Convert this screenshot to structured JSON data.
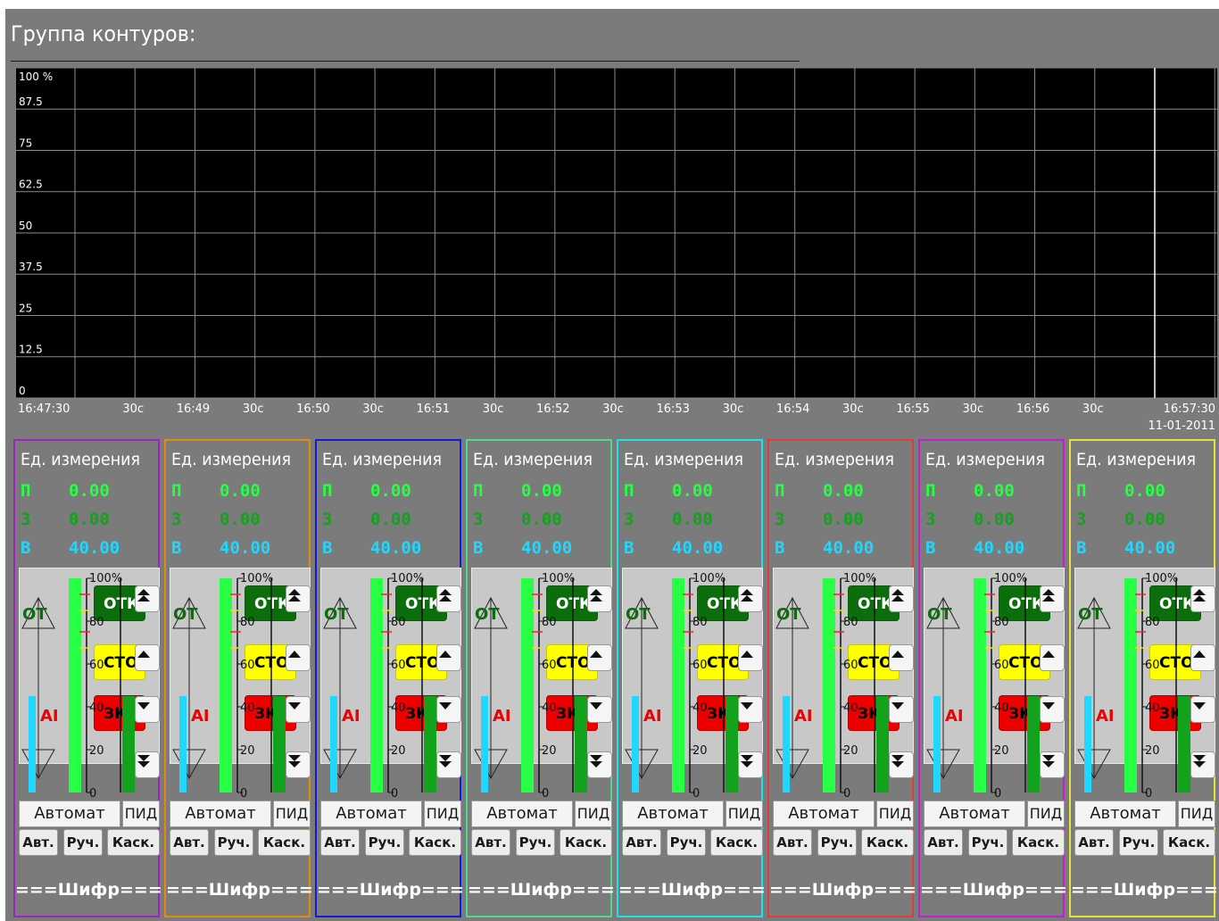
{
  "title": "Группа контуров:",
  "trend": {
    "y_ticks": [
      "100 %",
      "87.5",
      "75",
      "62.5",
      "50",
      "37.5",
      "25",
      "12.5",
      "0"
    ],
    "x_ticks": [
      "16:47:30",
      "30с",
      "16:49",
      "30с",
      "16:50",
      "30с",
      "16:51",
      "30с",
      "16:52",
      "30с",
      "16:53",
      "30с",
      "16:54",
      "30с",
      "16:55",
      "30с",
      "16:56",
      "30с",
      "16:57:30"
    ],
    "date": "11-01-2011",
    "background": "#000000",
    "grid_color": "#8c8c8c"
  },
  "colors": {
    "pv": "#26ff44",
    "sp": "#12a21c",
    "out": "#20d8ff",
    "alarm_hh": "#0b6d0b",
    "alarm_h": "#ffff00",
    "alarm_l": "#ee0000"
  },
  "gauge": {
    "scale": [
      "100%",
      "80",
      "60",
      "40",
      "20",
      "0"
    ],
    "left_letters": [
      "ОТ",
      "АI"
    ],
    "alarm_hh_label": "ОТК",
    "alarm_h_label": "СТО",
    "alarm_l_label": "ЗК"
  },
  "panels": [
    {
      "border": "#a020c0",
      "unit": "Ед. измерения",
      "p_label": "П",
      "p": "0.00",
      "z_label": "З",
      "z": "0.00",
      "v_label": "В",
      "v": "40.00",
      "pv_level": 1.0,
      "sp_level": 0.45,
      "out_level": 0.45,
      "mode": "Автомат",
      "algo": "ПИД",
      "btn_auto": "Авт.",
      "btn_manual": "Руч.",
      "btn_cascade": "Каск.",
      "cipher": "===Шифр==="
    },
    {
      "border": "#e08a10",
      "unit": "Ед. измерения",
      "p_label": "П",
      "p": "0.00",
      "z_label": "З",
      "z": "0.00",
      "v_label": "В",
      "v": "40.00",
      "pv_level": 1.0,
      "sp_level": 0.45,
      "out_level": 0.45,
      "mode": "Автомат",
      "algo": "ПИД",
      "btn_auto": "Авт.",
      "btn_manual": "Руч.",
      "btn_cascade": "Каск.",
      "cipher": "===Шифр==="
    },
    {
      "border": "#1818d0",
      "unit": "Ед. измерения",
      "p_label": "П",
      "p": "0.00",
      "z_label": "З",
      "z": "0.00",
      "v_label": "В",
      "v": "40.00",
      "pv_level": 1.0,
      "sp_level": 0.45,
      "out_level": 0.45,
      "mode": "Автомат",
      "algo": "ПИД",
      "btn_auto": "Авт.",
      "btn_manual": "Руч.",
      "btn_cascade": "Каск.",
      "cipher": "===Шифр==="
    },
    {
      "border": "#50d890",
      "unit": "Ед. измерения",
      "p_label": "П",
      "p": "0.00",
      "z_label": "З",
      "z": "0.00",
      "v_label": "В",
      "v": "40.00",
      "pv_level": 1.0,
      "sp_level": 0.45,
      "out_level": 0.45,
      "mode": "Автомат",
      "algo": "ПИД",
      "btn_auto": "Авт.",
      "btn_manual": "Руч.",
      "btn_cascade": "Каск.",
      "cipher": "===Шифр==="
    },
    {
      "border": "#20e0e8",
      "unit": "Ед. измерения",
      "p_label": "П",
      "p": "0.00",
      "z_label": "З",
      "z": "0.00",
      "v_label": "В",
      "v": "40.00",
      "pv_level": 1.0,
      "sp_level": 0.45,
      "out_level": 0.45,
      "mode": "Автомат",
      "algo": "ПИД",
      "btn_auto": "Авт.",
      "btn_manual": "Руч.",
      "btn_cascade": "Каск.",
      "cipher": "===Шифр==="
    },
    {
      "border": "#d84040",
      "unit": "Ед. измерения",
      "p_label": "П",
      "p": "0.00",
      "z_label": "З",
      "z": "0.00",
      "v_label": "В",
      "v": "40.00",
      "pv_level": 1.0,
      "sp_level": 0.45,
      "out_level": 0.45,
      "mode": "Автомат",
      "algo": "ПИД",
      "btn_auto": "Авт.",
      "btn_manual": "Руч.",
      "btn_cascade": "Каск.",
      "cipher": "===Шифр==="
    },
    {
      "border": "#c020d0",
      "unit": "Ед. измерения",
      "p_label": "П",
      "p": "0.00",
      "z_label": "З",
      "z": "0.00",
      "v_label": "В",
      "v": "40.00",
      "pv_level": 1.0,
      "sp_level": 0.45,
      "out_level": 0.45,
      "mode": "Автомат",
      "algo": "ПИД",
      "btn_auto": "Авт.",
      "btn_manual": "Руч.",
      "btn_cascade": "Каск.",
      "cipher": "===Шифр==="
    },
    {
      "border": "#e8e040",
      "unit": "Ед. измерения",
      "p_label": "П",
      "p": "0.00",
      "z_label": "З",
      "z": "0.00",
      "v_label": "В",
      "v": "40.00",
      "pv_level": 1.0,
      "sp_level": 0.45,
      "out_level": 0.45,
      "mode": "Автомат",
      "algo": "ПИД",
      "btn_auto": "Авт.",
      "btn_manual": "Руч.",
      "btn_cascade": "Каск.",
      "cipher": "===Шифр==="
    }
  ]
}
